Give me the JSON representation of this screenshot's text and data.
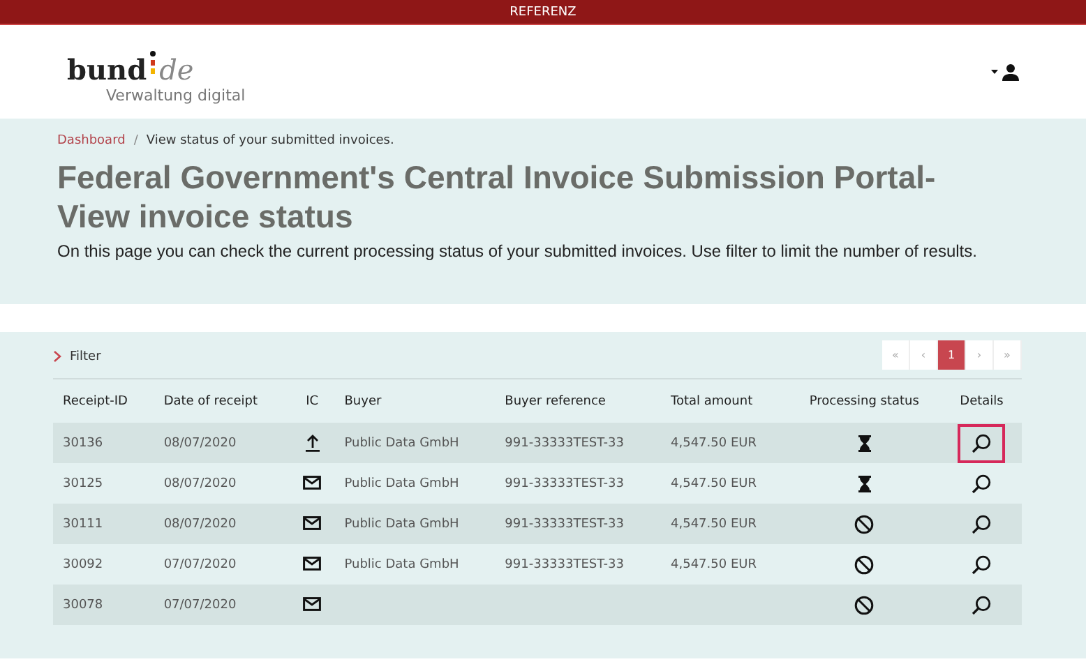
{
  "top_bar": {
    "label": "REFERENZ"
  },
  "logo": {
    "word": "bund",
    "suffix": "de",
    "tagline": "Verwaltung digital"
  },
  "breadcrumb": {
    "separator": "/",
    "items": [
      {
        "label": "Dashboard",
        "kind": "link"
      },
      {
        "label": "View status of your submitted invoices.",
        "kind": "current"
      }
    ]
  },
  "title": "Federal Government's Central Invoice Submission Portal- View invoice status",
  "intro": "On this page you can check the current processing status of your submitted invoices. Use filter to limit the number of results.",
  "filter": {
    "label": "Filter",
    "expanded": false
  },
  "pagination": [
    {
      "label": "«",
      "selected": false
    },
    {
      "label": "‹",
      "selected": false
    },
    {
      "label": "1",
      "selected": true
    },
    {
      "label": "›",
      "selected": false
    },
    {
      "label": "»",
      "selected": false
    }
  ],
  "table": {
    "columns": [
      "Receipt-ID",
      "Date of receipt",
      "IC",
      "Buyer",
      "Buyer reference",
      "Total amount",
      "Processing status",
      "Details"
    ],
    "rows": [
      {
        "id": "30136",
        "date": "08/07/2020",
        "ic": {
          "kind": "upload"
        },
        "buyer": "Public Data GmbH",
        "reference": "991-33333TEST-33",
        "amount": "4,547.50 EUR",
        "status": {
          "kind": "pending"
        },
        "selected": true
      },
      {
        "id": "30125",
        "date": "08/07/2020",
        "ic": {
          "kind": "mail"
        },
        "buyer": "Public Data GmbH",
        "reference": "991-33333TEST-33",
        "amount": "4,547.50 EUR",
        "status": {
          "kind": "pending"
        },
        "selected": false
      },
      {
        "id": "30111",
        "date": "08/07/2020",
        "ic": {
          "kind": "mail"
        },
        "buyer": "Public Data GmbH",
        "reference": "991-33333TEST-33",
        "amount": "4,547.50 EUR",
        "status": {
          "kind": "rejected"
        },
        "selected": false
      },
      {
        "id": "30092",
        "date": "07/07/2020",
        "ic": {
          "kind": "mail"
        },
        "buyer": "Public Data GmbH",
        "reference": "991-33333TEST-33",
        "amount": "4,547.50 EUR",
        "status": {
          "kind": "rejected"
        },
        "selected": false
      },
      {
        "id": "30078",
        "date": "07/07/2020",
        "ic": {
          "kind": "mail"
        },
        "status": {
          "kind": "rejected"
        },
        "selected": false
      }
    ]
  }
}
